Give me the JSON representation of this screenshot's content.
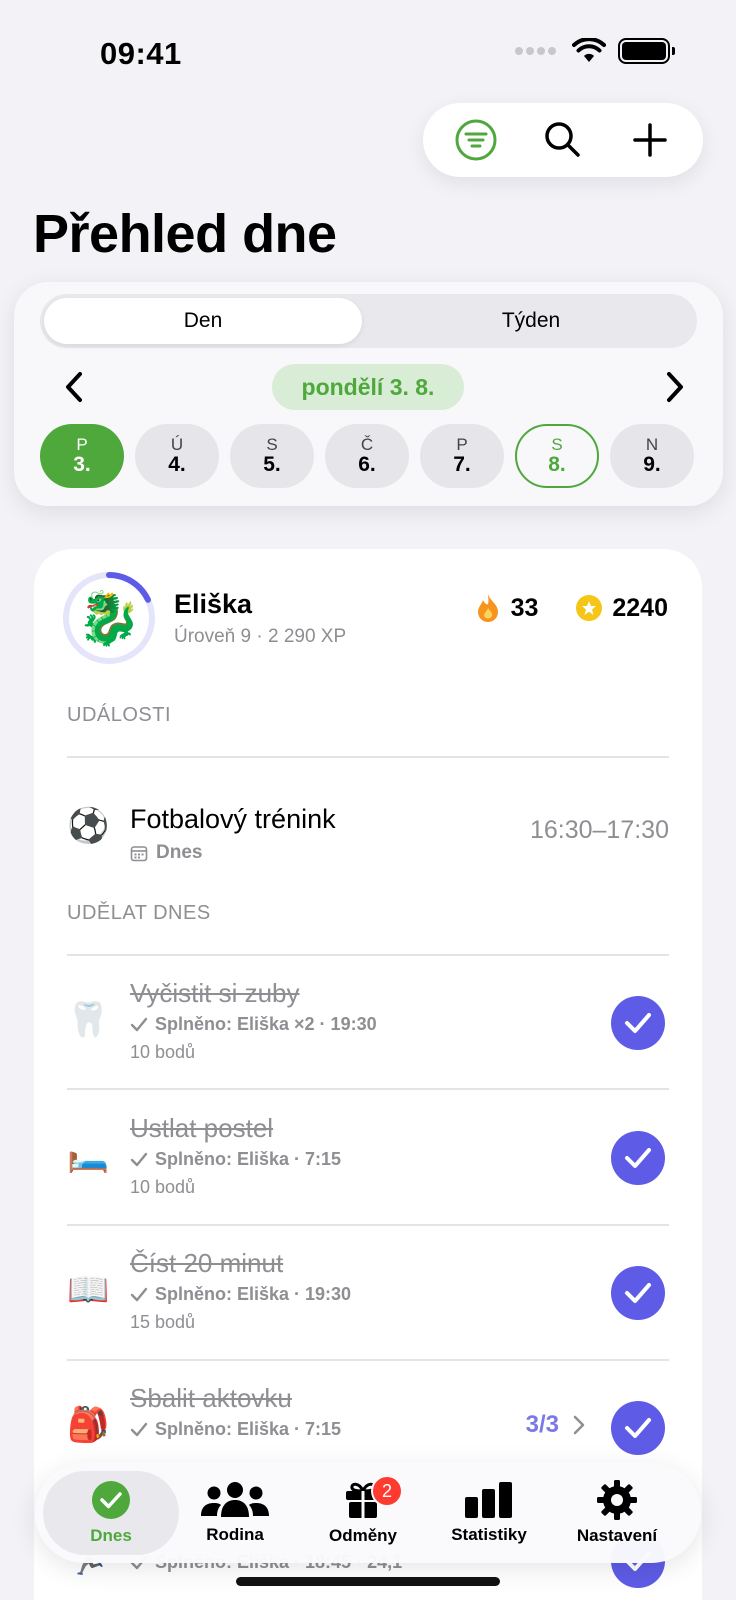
{
  "status_bar": {
    "time": "09:41"
  },
  "page": {
    "title": "Přehled dne"
  },
  "segmented": {
    "day": "Den",
    "week": "Týden"
  },
  "date_nav": {
    "current_date": "pondělí 3. 8."
  },
  "days": [
    {
      "letter": "P",
      "number": "3.",
      "state": "selected"
    },
    {
      "letter": "Ú",
      "number": "4.",
      "state": "normal"
    },
    {
      "letter": "S",
      "number": "5.",
      "state": "normal"
    },
    {
      "letter": "Č",
      "number": "6.",
      "state": "normal"
    },
    {
      "letter": "P",
      "number": "7.",
      "state": "normal"
    },
    {
      "letter": "S",
      "number": "8.",
      "state": "today"
    },
    {
      "letter": "N",
      "number": "9.",
      "state": "normal"
    }
  ],
  "child": {
    "name": "Eliška",
    "level": "Úroveň 9 · 2 290 XP",
    "avatar": "🐉",
    "level_progress": 0.18,
    "streak": "33",
    "coins": "2240"
  },
  "events_section": {
    "label": "UDÁLOSTI"
  },
  "events": [
    {
      "emoji": "⚽",
      "title": "Fotbalový trénink",
      "when": "Dnes",
      "time": "16:30–17:30"
    }
  ],
  "tasks_section": {
    "label": "UDĚLAT DNES"
  },
  "tasks": [
    {
      "emoji": "🦷",
      "title": "Vyčistit si zuby",
      "done": "Splněno: Eliška ×2 · 19:30",
      "points": "10 bodů"
    },
    {
      "emoji": "🛏️",
      "title": "Ustlat postel",
      "done": "Splněno: Eliška · 7:15",
      "points": "10 bodů"
    },
    {
      "emoji": "📖",
      "title": "Číst 20 minut",
      "done": "Splněno: Eliška · 19:30",
      "points": "15 bodů"
    },
    {
      "emoji": "🎒",
      "title": "Sbalit aktovku",
      "done": "Splněno: Eliška · 7:15",
      "points": "",
      "progress": "3/3"
    },
    {
      "emoji": "🏃",
      "title": "",
      "done": "Splněno: Eliška · 18:45 · 24,1",
      "points": ""
    }
  ],
  "tabbar": {
    "items": [
      {
        "label": "Dnes",
        "icon": "check-circle-icon",
        "active": true
      },
      {
        "label": "Rodina",
        "icon": "people-icon",
        "active": false
      },
      {
        "label": "Odměny",
        "icon": "gift-icon",
        "active": false,
        "badge": "2"
      },
      {
        "label": "Statistiky",
        "icon": "bar-chart-icon",
        "active": false
      },
      {
        "label": "Nastavení",
        "icon": "gear-icon",
        "active": false
      }
    ]
  },
  "colors": {
    "accent_green": "#4ea83c",
    "accent_purple": "#5e5ce6",
    "badge_red": "#ff3b30"
  }
}
